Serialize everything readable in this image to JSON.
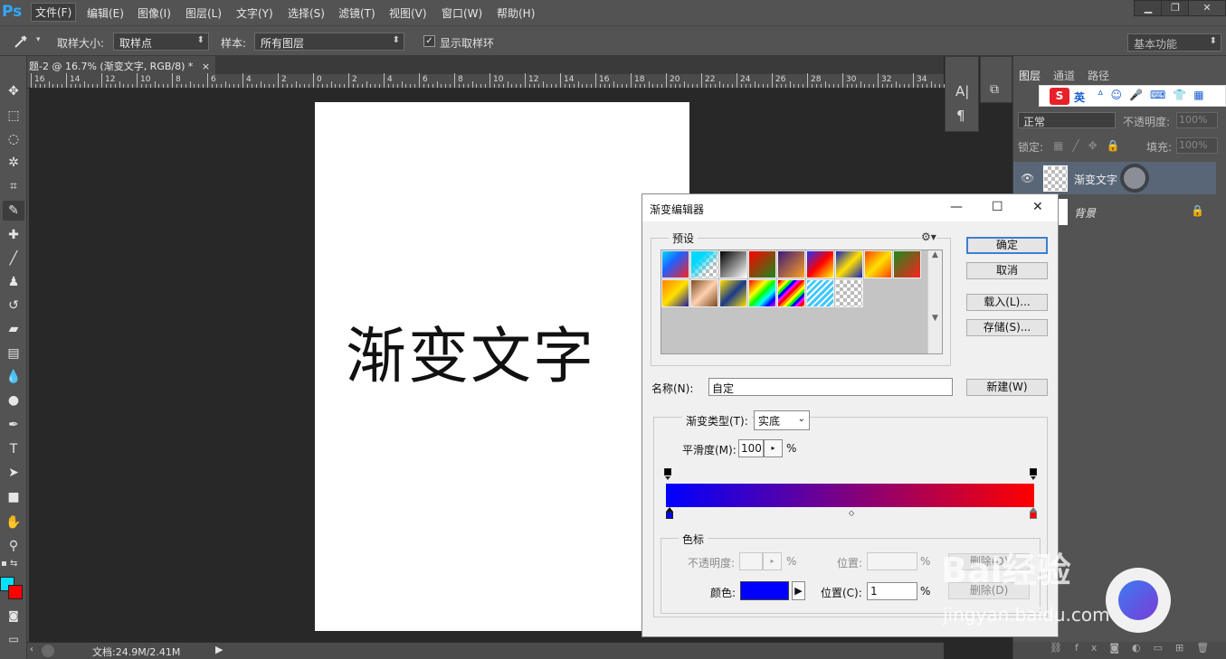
{
  "app": {
    "logo": "Ps"
  },
  "menu": [
    "文件(F)",
    "编辑(E)",
    "图像(I)",
    "图层(L)",
    "文字(Y)",
    "选择(S)",
    "滤镜(T)",
    "视图(V)",
    "窗口(W)",
    "帮助(H)"
  ],
  "window_controls": {
    "minimize": "▁",
    "restore": "❐",
    "close": "✕"
  },
  "options_bar": {
    "sample_size_label": "取样大小:",
    "sample_size_value": "取样点",
    "sample_label": "样本:",
    "sample_value": "所有图层",
    "show_ring_label": "显示取样环",
    "workspace": "基本功能"
  },
  "document": {
    "tab_title": "题-2 @ 16.7% (渐变文字, RGB/8) *",
    "tab_close": "×",
    "canvas_text": "渐变文字",
    "status": "文档:24.9M/2.41M"
  },
  "ruler": [
    "16",
    "14",
    "12",
    "10",
    "8",
    "6",
    "4",
    "2",
    "0",
    "2",
    "4",
    "6",
    "8",
    "10",
    "12",
    "14",
    "16",
    "18",
    "20",
    "22",
    "24",
    "26",
    "28",
    "30",
    "32",
    "34"
  ],
  "layers_panel": {
    "tabs": [
      "图层",
      "通道",
      "路径"
    ],
    "blend_mode": "正常",
    "opacity_label": "不透明度:",
    "opacity_value": "100%",
    "lock_label": "锁定:",
    "fill_label": "填充:",
    "fill_value": "100%",
    "layers": [
      {
        "name": "渐变文字",
        "selected": true
      },
      {
        "name": "背景",
        "locked": true
      }
    ],
    "ime_label": "英"
  },
  "gradient_editor": {
    "title": "渐变编辑器",
    "presets_label": "预设",
    "ok": "确定",
    "cancel": "取消",
    "load": "载入(L)...",
    "save": "存储(S)...",
    "name_label": "名称(N):",
    "name_value": "自定",
    "new": "新建(W)",
    "type_label": "渐变类型(T):",
    "type_value": "实底",
    "smooth_label": "平滑度(M):",
    "smooth_value": "100",
    "percent": "%",
    "stops_label": "色标",
    "opacity_label": "不透明度:",
    "location_label": "位置:",
    "delete": "删除(D)",
    "color_label": "颜色:",
    "location_c_label": "位置(C):",
    "location_c_value": "1",
    "start_color": "#0000ff",
    "end_color": "#ff0000"
  },
  "watermark": {
    "brand": "Bai经验",
    "url": "jingyan.baidu.com"
  }
}
